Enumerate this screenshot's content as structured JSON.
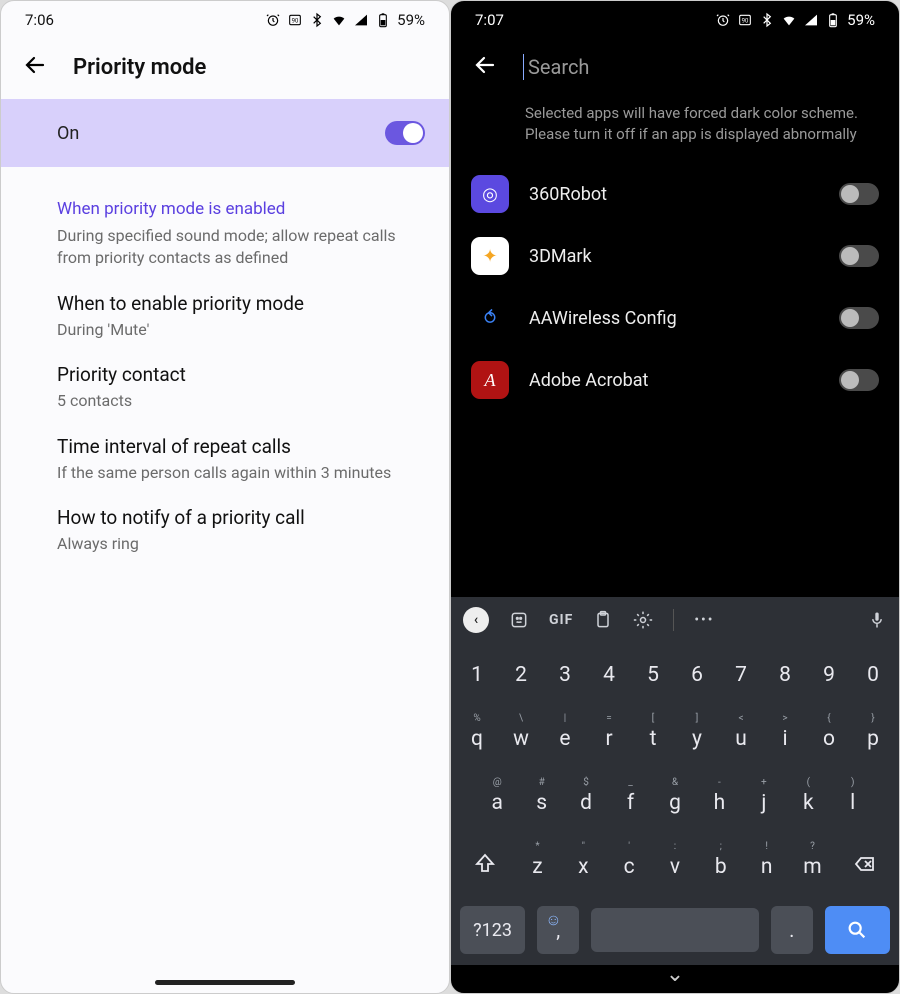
{
  "left": {
    "status": {
      "time": "7:06",
      "battery": "59%"
    },
    "title": "Priority mode",
    "on_label": "On",
    "on_state": true,
    "section": {
      "header": "When priority mode is enabled",
      "desc": "During specified sound mode; allow repeat calls from priority contacts as defined"
    },
    "items": [
      {
        "title": "When to enable priority mode",
        "sub": "During 'Mute'"
      },
      {
        "title": "Priority contact",
        "sub": "5 contacts"
      },
      {
        "title": "Time interval of repeat calls",
        "sub": "If the same person calls again within 3 minutes"
      },
      {
        "title": "How to notify of a priority call",
        "sub": "Always ring"
      }
    ]
  },
  "right": {
    "status": {
      "time": "7:07",
      "battery": "59%"
    },
    "search_placeholder": "Search",
    "search_value": "",
    "hint": "Selected apps will have forced dark color scheme. Please turn it off if an app is displayed abnormally",
    "apps": [
      {
        "name": "360Robot",
        "on": false,
        "icon": "360robot",
        "bg": "#5b49e0",
        "fg": "#ffffff"
      },
      {
        "name": "3DMark",
        "on": false,
        "icon": "3dmark",
        "bg": "#ffffff",
        "fg": "#f5a623"
      },
      {
        "name": "AAWireless Config",
        "on": false,
        "icon": "aawire",
        "bg": "transparent",
        "fg": "#3b82f6"
      },
      {
        "name": "Adobe Acrobat",
        "on": false,
        "icon": "acrobat",
        "bg": "#b11313",
        "fg": "#ffffff"
      }
    ]
  },
  "keyboard": {
    "toolbar": {
      "gif": "GIF",
      "more": "•••"
    },
    "row_num": [
      "1",
      "2",
      "3",
      "4",
      "5",
      "6",
      "7",
      "8",
      "9",
      "0"
    ],
    "row1": [
      "q",
      "w",
      "e",
      "r",
      "t",
      "y",
      "u",
      "i",
      "o",
      "p"
    ],
    "row1_hint": [
      "%",
      "\\",
      "|",
      "=",
      "[",
      "]",
      "<",
      ">",
      "{",
      "}"
    ],
    "row2": [
      "a",
      "s",
      "d",
      "f",
      "g",
      "h",
      "j",
      "k",
      "l"
    ],
    "row2_hint": [
      "@",
      "#",
      "$",
      "_",
      "&",
      "-",
      "+",
      "(",
      ")"
    ],
    "row3": [
      "z",
      "x",
      "c",
      "v",
      "b",
      "n",
      "m"
    ],
    "row3_hint": [
      "*",
      "\"",
      "'",
      ":",
      ";",
      "!",
      "?"
    ],
    "sym": "?123",
    "comma": ",",
    "period": "."
  }
}
